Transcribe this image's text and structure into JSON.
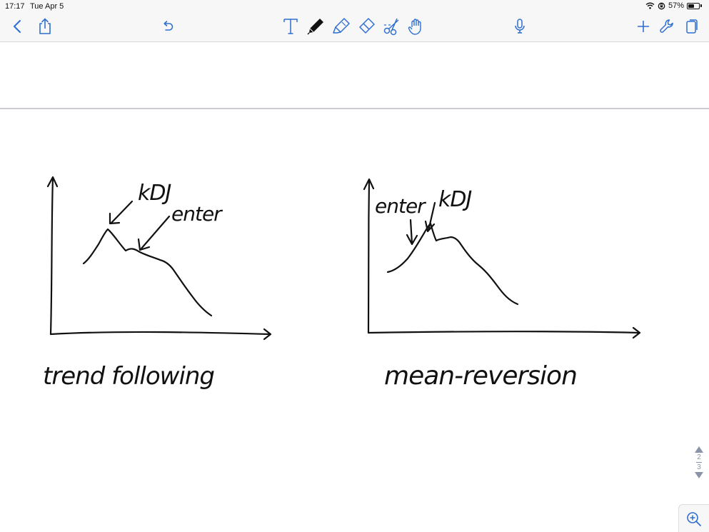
{
  "status_bar": {
    "time": "17:17",
    "date": "Tue Apr 5",
    "battery_text": "57%",
    "battery_level": 0.57
  },
  "toolbar": {
    "left": [
      "back-icon",
      "share-icon",
      "undo-icon"
    ],
    "tools": [
      "text-tool-icon",
      "pen-tool-icon",
      "highlighter-tool-icon",
      "eraser-tool-icon",
      "scissors-tool-icon",
      "hand-tool-icon"
    ],
    "center": [
      "microphone-icon"
    ],
    "right": [
      "add-icon",
      "wrench-icon",
      "pages-icon"
    ],
    "accent_color": "#2f6fd0"
  },
  "notes": {
    "left_chart": {
      "annotation_kdj": "kDJ",
      "annotation_enter": "enter",
      "caption": "trend following"
    },
    "right_chart": {
      "annotation_enter": "enter",
      "annotation_kdj": "kDJ",
      "caption": "mean-reversion"
    }
  },
  "pager": {
    "current": "2",
    "total": "3"
  },
  "zoom_icon": "zoom-in-icon"
}
